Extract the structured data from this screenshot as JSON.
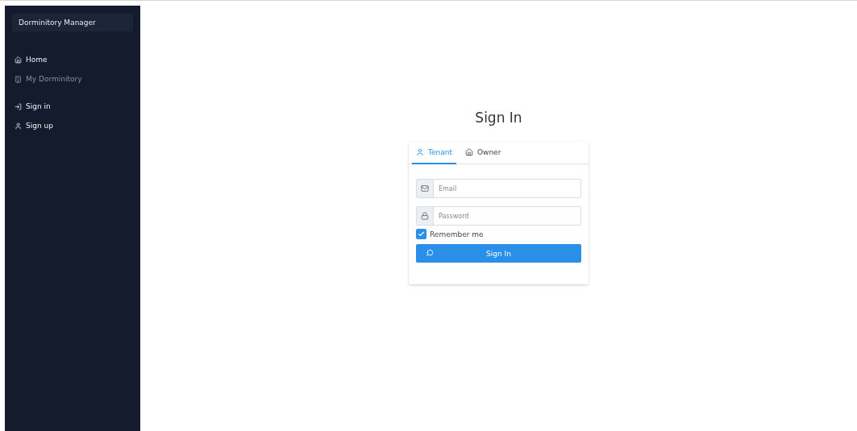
{
  "sidebar": {
    "title": "Dorminitory Manager",
    "groups": [
      [
        {
          "label": "Home",
          "kind": "home",
          "disabled": false
        },
        {
          "label": "My Dorminitory",
          "kind": "building",
          "disabled": true
        }
      ],
      [
        {
          "label": "Sign in",
          "kind": "login",
          "disabled": false
        },
        {
          "label": "Sign up",
          "kind": "user",
          "disabled": false
        }
      ]
    ]
  },
  "heading": "Sign In",
  "tabs": [
    {
      "label": "Tenant",
      "kind": "user",
      "selected": true
    },
    {
      "label": "Owner",
      "kind": "home",
      "selected": false
    }
  ],
  "fields": [
    {
      "placeholder": "Email",
      "kind": "mail"
    },
    {
      "placeholder": "Password",
      "kind": "lock"
    }
  ],
  "remember": {
    "label": "Remember me",
    "checked": true
  },
  "submit": {
    "label": "Sign In"
  }
}
